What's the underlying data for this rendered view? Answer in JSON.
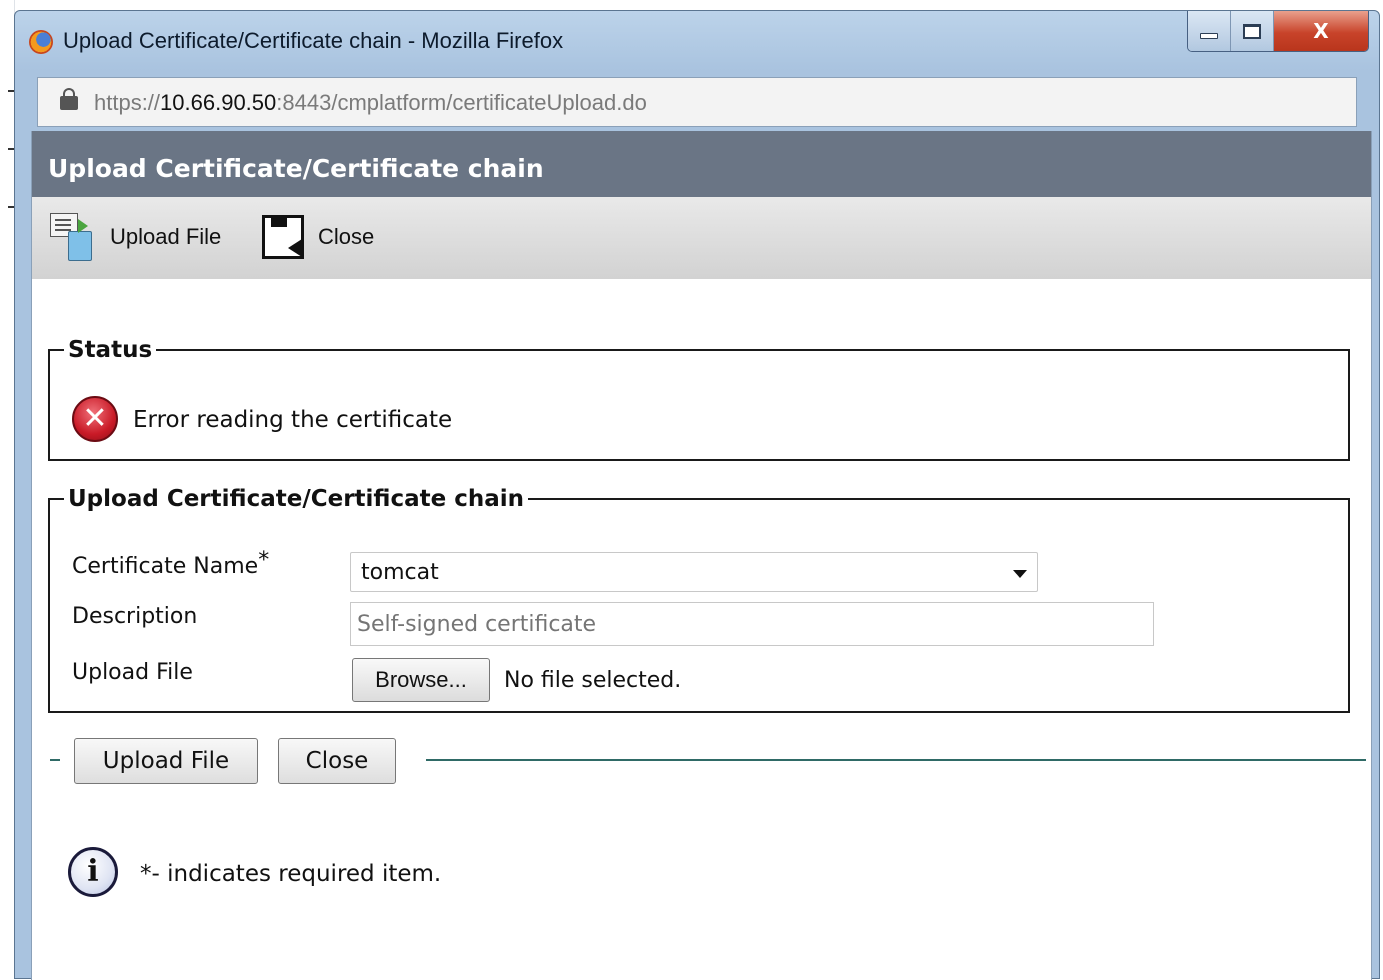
{
  "window": {
    "title": "Upload Certificate/Certificate chain - Mozilla Firefox",
    "close_glyph": "X"
  },
  "url": {
    "prefix": "https://",
    "host": "10.66.90.50",
    "rest": ":8443/cmplatform/certificateUpload.do"
  },
  "page": {
    "title": "Upload Certificate/Certificate chain"
  },
  "toolbar": {
    "upload_label": "Upload File",
    "close_label": "Close"
  },
  "status": {
    "legend": "Status",
    "message": "Error reading the certificate"
  },
  "form": {
    "legend": "Upload Certificate/Certificate chain",
    "certificate_name_label": "Certificate Name",
    "required_marker": "*",
    "certificate_name_value": "tomcat",
    "description_label": "Description",
    "description_placeholder": "Self-signed certificate",
    "upload_file_label": "Upload File",
    "browse_label": "Browse...",
    "file_status": "No file selected."
  },
  "actions": {
    "upload_label": "Upload File",
    "close_label": "Close"
  },
  "note": {
    "text": "*- indicates required item."
  }
}
